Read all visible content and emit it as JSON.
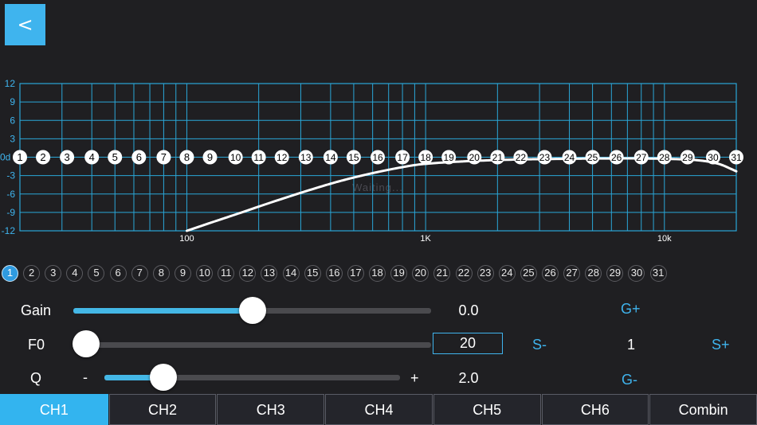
{
  "header": {
    "back_label": "<"
  },
  "chart_data": {
    "type": "line",
    "y_ticks": [
      "12",
      "9",
      "6",
      "3",
      "0d",
      "-3",
      "-6",
      "-9",
      "-12"
    ],
    "ylim": [
      -12,
      12
    ],
    "x_tick_labels": [
      "100",
      "1K",
      "10k"
    ],
    "x_scale": "log",
    "xlim": [
      20,
      20000
    ],
    "watermark": "Waiting...",
    "grid": true,
    "band_markers": [
      "1",
      "2",
      "3",
      "4",
      "5",
      "6",
      "7",
      "8",
      "9",
      "10",
      "11",
      "12",
      "13",
      "14",
      "15",
      "16",
      "17",
      "18",
      "19",
      "20",
      "21",
      "22",
      "23",
      "24",
      "25",
      "26",
      "27",
      "28",
      "29",
      "30",
      "31"
    ],
    "band_frequencies": [
      20,
      25,
      31.5,
      40,
      50,
      63,
      80,
      100,
      125,
      160,
      200,
      250,
      315,
      400,
      500,
      630,
      800,
      1000,
      1250,
      1600,
      2000,
      2500,
      3150,
      4000,
      5000,
      6300,
      8000,
      10000,
      12500,
      16000,
      20000
    ],
    "series": [
      {
        "x": [
          100,
          130,
          170,
          220,
          300,
          400,
          500,
          630,
          800,
          1000,
          2000,
          5000,
          10000,
          16000,
          20000
        ],
        "y": [
          -12,
          -10.5,
          -9,
          -7.5,
          -5.8,
          -4.3,
          -3.3,
          -2.4,
          -1.6,
          -1.0,
          -0.4,
          -0.2,
          -0.2,
          -0.6,
          -2.3
        ]
      }
    ]
  },
  "bands": {
    "selected": 1,
    "items": [
      "1",
      "2",
      "3",
      "4",
      "5",
      "6",
      "7",
      "8",
      "9",
      "10",
      "11",
      "12",
      "13",
      "14",
      "15",
      "16",
      "17",
      "18",
      "19",
      "20",
      "21",
      "22",
      "23",
      "24",
      "25",
      "26",
      "27",
      "28",
      "29",
      "30",
      "31"
    ]
  },
  "controls": {
    "gain": {
      "label": "Gain",
      "value": "0.0",
      "level": 0.5,
      "plus_label": "G+"
    },
    "f0": {
      "label": "F0",
      "value": "20",
      "level": 0.0,
      "minus_label": "S-",
      "step": "1",
      "plus_label": "S+"
    },
    "q": {
      "label": "Q",
      "value": "2.0",
      "level": 0.2,
      "minus_sign": "-",
      "plus_sign": "+",
      "minus_label": "G-"
    }
  },
  "tabs": {
    "active": 0,
    "items": [
      "CH1",
      "CH2",
      "CH3",
      "CH4",
      "CH5",
      "CH6",
      "Combin"
    ]
  },
  "colors": {
    "accent": "#33b4ef",
    "grid": "#2aa7d8",
    "background": "#1f1f22",
    "curve": "#ffffff"
  }
}
